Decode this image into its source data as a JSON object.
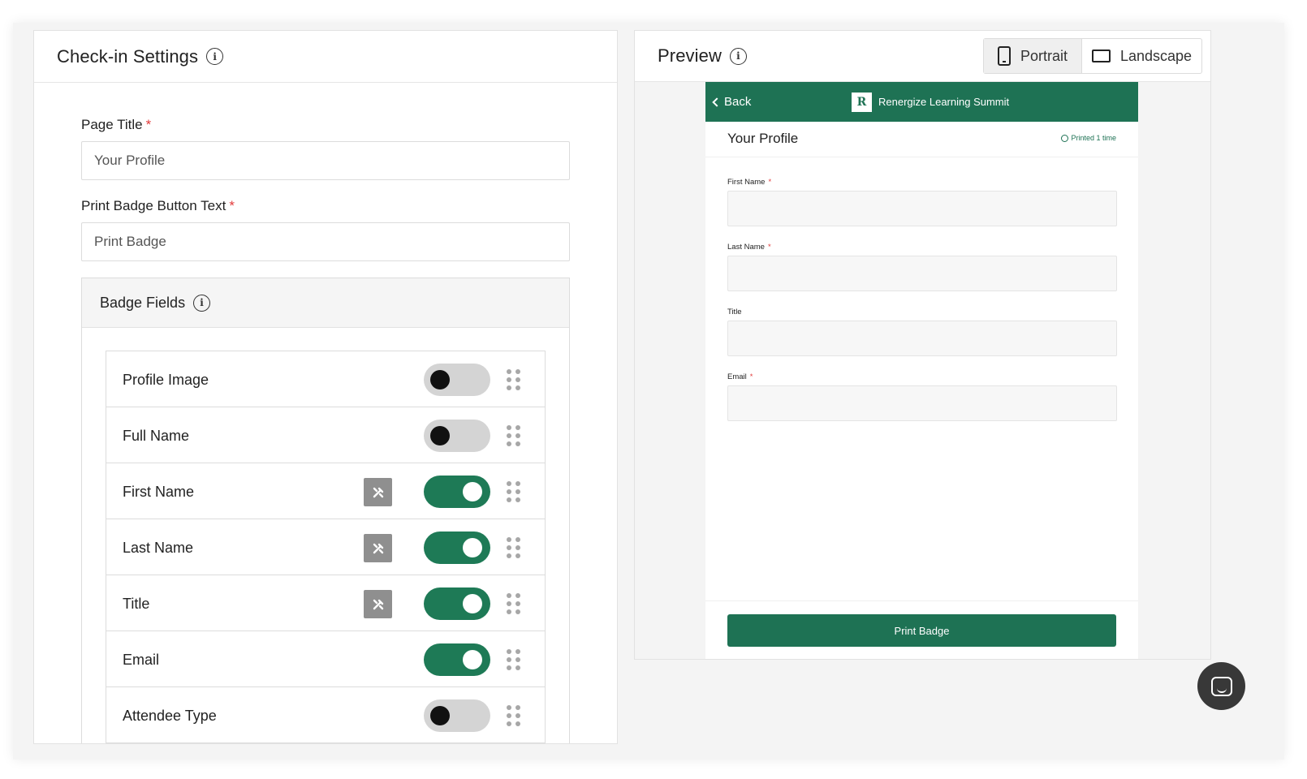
{
  "settings": {
    "title": "Check-in Settings",
    "info_icon": "info-icon",
    "page_title": {
      "label": "Page Title",
      "required_mark": "*",
      "value": "Your Profile"
    },
    "print_text": {
      "label": "Print Badge Button Text",
      "required_mark": "*",
      "value": "Print Badge"
    },
    "badge_fields": {
      "title": "Badge Fields",
      "items": [
        {
          "label": "Profile Image",
          "enabled": false,
          "editable": false
        },
        {
          "label": "Full Name",
          "enabled": false,
          "editable": false
        },
        {
          "label": "First Name",
          "enabled": true,
          "editable": true
        },
        {
          "label": "Last Name",
          "enabled": true,
          "editable": true
        },
        {
          "label": "Title",
          "enabled": true,
          "editable": true
        },
        {
          "label": "Email",
          "enabled": true,
          "editable": false
        },
        {
          "label": "Attendee Type",
          "enabled": false,
          "editable": false
        }
      ]
    }
  },
  "preview": {
    "title": "Preview",
    "views": {
      "portrait": "Portrait",
      "landscape": "Landscape",
      "selected": "portrait"
    },
    "device": {
      "back_label": "Back",
      "event_name": "Renergize Learning Summit",
      "logo_letter": "R",
      "page_title": "Your Profile",
      "printed_status": "Printed 1 time",
      "fields": [
        {
          "label": "First Name",
          "required": "*"
        },
        {
          "label": "Last Name",
          "required": "*"
        },
        {
          "label": "Title",
          "required": ""
        },
        {
          "label": "Email",
          "required": "*"
        }
      ],
      "print_button": "Print Badge"
    }
  },
  "colors": {
    "brand_green": "#1e7254",
    "toggle_on": "#1e7a56",
    "toggle_off": "#d4d4d4",
    "required": "#e23b3b"
  }
}
